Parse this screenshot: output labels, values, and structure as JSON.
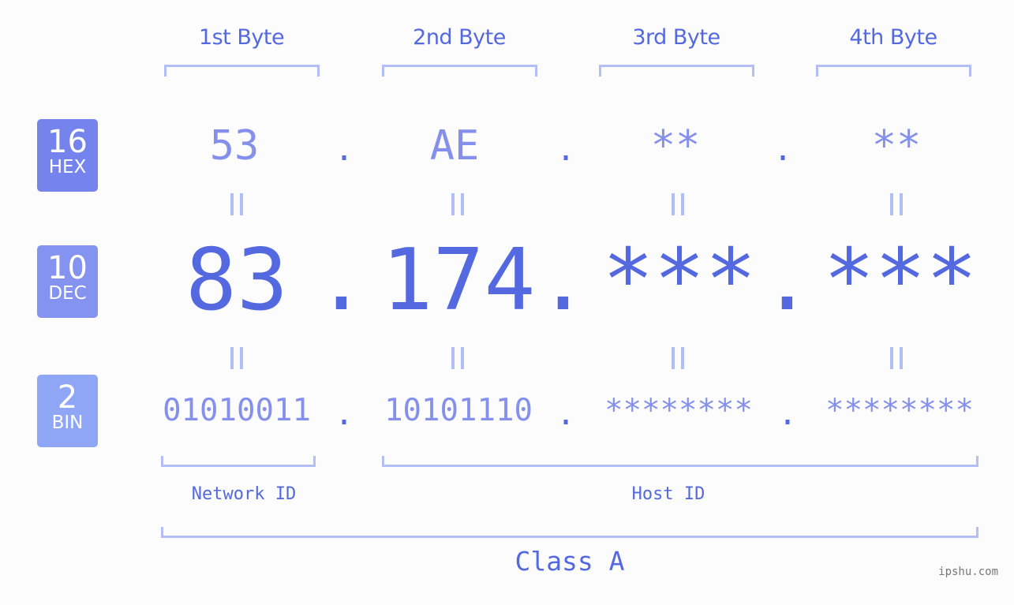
{
  "bytes": {
    "headers": [
      "1st Byte",
      "2nd Byte",
      "3rd Byte",
      "4th Byte"
    ]
  },
  "bases": {
    "hex": {
      "number": "16",
      "label": "HEX",
      "color": "#7584ec"
    },
    "dec": {
      "number": "10",
      "label": "DEC",
      "color": "#8593f0"
    },
    "bin": {
      "number": "2",
      "label": "BIN",
      "color": "#8fa6f6"
    }
  },
  "address": {
    "separator": ".",
    "equals": "=",
    "hex": [
      "53",
      "AE",
      "**",
      "**"
    ],
    "dec": [
      "83",
      "174",
      "***",
      "***"
    ],
    "bin": [
      "01010011",
      "10101110",
      "********",
      "********"
    ]
  },
  "segments": {
    "network": "Network ID",
    "host": "Host ID",
    "class": "Class A"
  },
  "colors": {
    "primary": "#5468e0",
    "secondary": "#8490ec",
    "bracket": "#b3bef6"
  },
  "watermark": "ipshu.com"
}
